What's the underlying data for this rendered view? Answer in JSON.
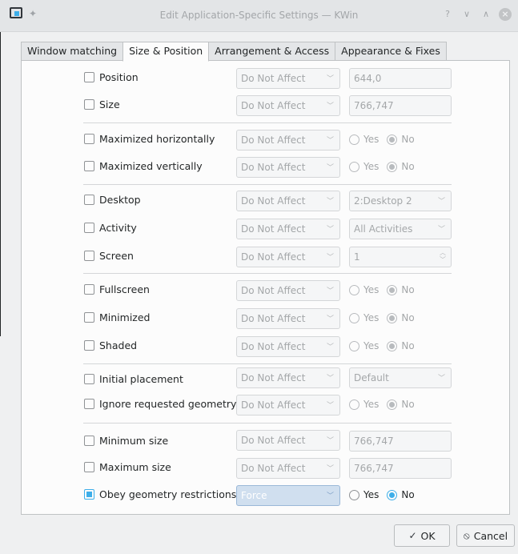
{
  "window": {
    "title": "Edit Application-Specific Settings — KWin",
    "icons": [
      "kwin-app-icon",
      "pin-icon",
      "help-icon",
      "minimize-icon",
      "maximize-icon",
      "close-icon"
    ],
    "help_glyph": "?",
    "minimize_glyph": "∨",
    "maximize_glyph": "∧",
    "close_glyph": "×"
  },
  "tabs": [
    {
      "label": "Window matching"
    },
    {
      "label": "Size & Position"
    },
    {
      "label": "Arrangement & Access"
    },
    {
      "label": "Appearance & Fixes"
    }
  ],
  "rules": {
    "position": {
      "label": "Position",
      "checked": false,
      "policy": "Do Not Affect",
      "value": "644,0"
    },
    "size": {
      "label": "Size",
      "checked": false,
      "policy": "Do Not Affect",
      "value": "766,747"
    },
    "max_h": {
      "label": "Maximized horizontally",
      "checked": false,
      "policy": "Do Not Affect",
      "yes": "Yes",
      "no": "No",
      "selected": "No"
    },
    "max_v": {
      "label": "Maximized vertically",
      "checked": false,
      "policy": "Do Not Affect",
      "yes": "Yes",
      "no": "No",
      "selected": "No"
    },
    "desktop": {
      "label": "Desktop",
      "checked": false,
      "policy": "Do Not Affect",
      "value": "2:Desktop 2"
    },
    "activity": {
      "label": "Activity",
      "checked": false,
      "policy": "Do Not Affect",
      "value": "All Activities"
    },
    "screen": {
      "label": "Screen",
      "checked": false,
      "policy": "Do Not Affect",
      "value": "1"
    },
    "fullscreen": {
      "label": "Fullscreen",
      "checked": false,
      "policy": "Do Not Affect",
      "yes": "Yes",
      "no": "No",
      "selected": "No"
    },
    "minimized": {
      "label": "Minimized",
      "checked": false,
      "policy": "Do Not Affect",
      "yes": "Yes",
      "no": "No",
      "selected": "No"
    },
    "shaded": {
      "label": "Shaded",
      "checked": false,
      "policy": "Do Not Affect",
      "yes": "Yes",
      "no": "No",
      "selected": "No"
    },
    "placement": {
      "label": "Initial placement",
      "checked": false,
      "policy": "Do Not Affect",
      "value": "Default"
    },
    "ignore_geom": {
      "label": "Ignore requested geometry",
      "checked": false,
      "policy": "Do Not Affect",
      "yes": "Yes",
      "no": "No",
      "selected": "No"
    },
    "min_size": {
      "label": "Minimum size",
      "checked": false,
      "policy": "Do Not Affect",
      "value": "766,747"
    },
    "max_size": {
      "label": "Maximum size",
      "checked": false,
      "policy": "Do Not Affect",
      "value": "766,747"
    },
    "obey": {
      "label": "Obey geometry restrictions",
      "checked": true,
      "policy": "Force",
      "yes": "Yes",
      "no": "No",
      "selected": "No"
    }
  },
  "buttons": {
    "ok": {
      "label": "OK",
      "icon": "checkmark-icon",
      "glyph": "✓"
    },
    "cancel": {
      "label": "Cancel",
      "icon": "cancel-icon",
      "glyph": "⦸"
    }
  },
  "colors": {
    "accent": "#3daee9",
    "window_bg": "#eff0f1",
    "panel_bg": "#fcfcfc",
    "disabled_text": "#a4a7a9"
  }
}
